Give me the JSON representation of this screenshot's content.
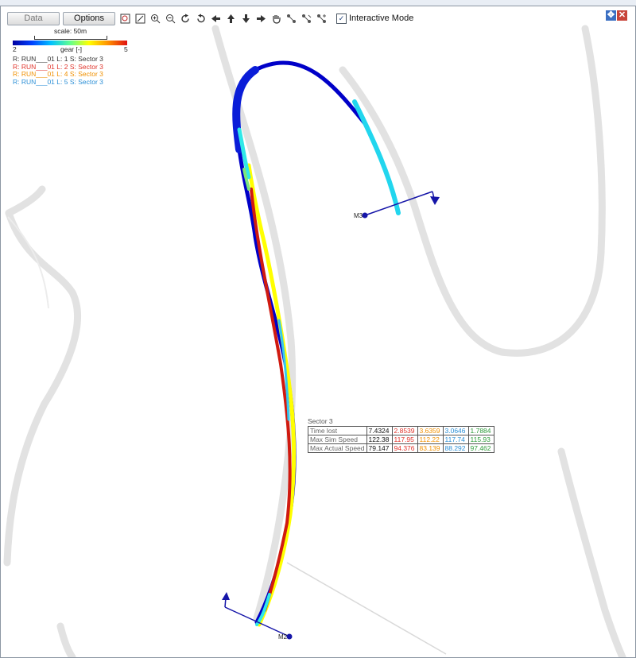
{
  "toolbar": {
    "data_label": "Data",
    "options_label": "Options",
    "icons": [
      "zoom-rect",
      "zoom-fit",
      "zoom-in",
      "zoom-out",
      "rotate-cw",
      "rotate-ccw",
      "pan-left",
      "pan-up",
      "pan-down",
      "pan-right",
      "hand-pan",
      "select-add",
      "select-remove",
      "select-toggle"
    ],
    "interactive_label": "Interactive Mode",
    "interactive_checked": true
  },
  "legend": {
    "scale_label": "scale: 50m",
    "gear_min": "2",
    "gear_label": "gear [-]",
    "gear_max": "5",
    "runs": [
      {
        "text": "R: RUN___01  L: 1  S: Sector 3",
        "color": "#333333"
      },
      {
        "text": "R: RUN___01  L: 2  S: Sector 3",
        "color": "#e0342b"
      },
      {
        "text": "R: RUN___01  L: 4  S: Sector 3",
        "color": "#f09000"
      },
      {
        "text": "R: RUN___01  L: 5  S: Sector 3",
        "color": "#2b8fd6"
      }
    ]
  },
  "map": {
    "marker_top": "M3",
    "marker_bottom": "M2"
  },
  "table": {
    "title": "Sector 3",
    "column_colors": [
      "#111111",
      "#e0342b",
      "#f09000",
      "#2b8fd6",
      "#2e9b3a"
    ],
    "rows": [
      {
        "label": "Time lost",
        "values": [
          "7.4324",
          "2.8539",
          "3.6359",
          "3.0646",
          "1.7884"
        ]
      },
      {
        "label": "Max Sim Speed",
        "values": [
          "122.38",
          "117.95",
          "112.22",
          "117.74",
          "115.93"
        ]
      },
      {
        "label": "Max Actual Speed",
        "values": [
          "79.147",
          "94.376",
          "83.139",
          "88.292",
          "97.462"
        ]
      }
    ]
  }
}
